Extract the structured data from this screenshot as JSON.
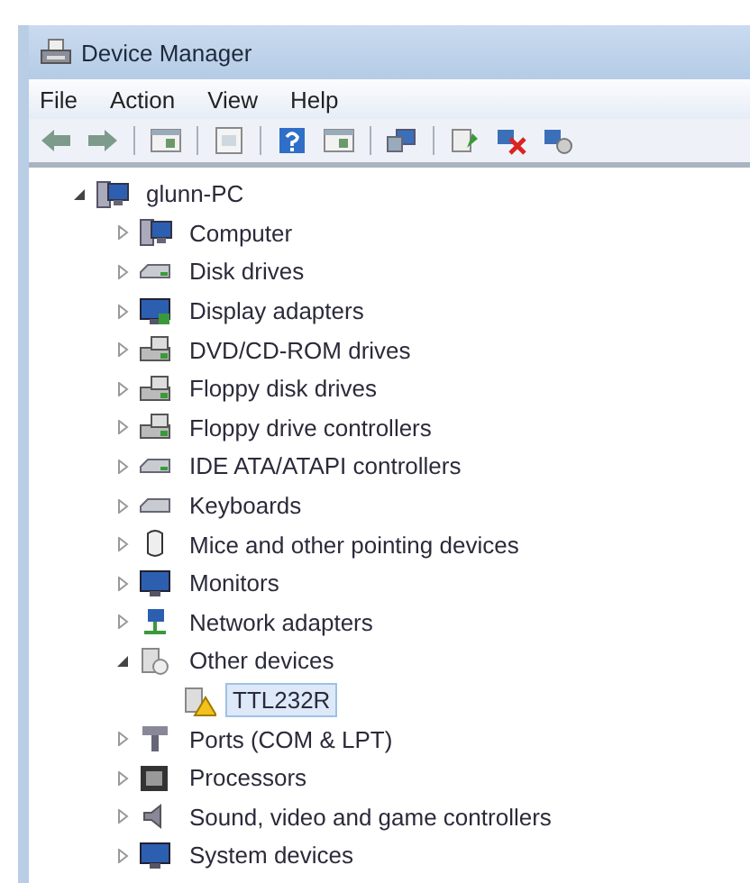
{
  "window": {
    "title": "Device Manager"
  },
  "menu": [
    {
      "label": "File"
    },
    {
      "label": "Action"
    },
    {
      "label": "View"
    },
    {
      "label": "Help"
    }
  ],
  "toolbar": [
    {
      "kind": "back"
    },
    {
      "kind": "forward"
    },
    {
      "kind": "sep"
    },
    {
      "kind": "pane"
    },
    {
      "kind": "sep"
    },
    {
      "kind": "sheet"
    },
    {
      "kind": "sep"
    },
    {
      "kind": "help"
    },
    {
      "kind": "pane2"
    },
    {
      "kind": "sep"
    },
    {
      "kind": "scan"
    },
    {
      "kind": "sep"
    },
    {
      "kind": "update"
    },
    {
      "kind": "uninstall"
    },
    {
      "kind": "disable"
    }
  ],
  "tree": [
    {
      "label": "glunn-PC",
      "kind": "root",
      "expanded": true,
      "selected": false,
      "children": [
        {
          "label": "Computer",
          "kind": "computer",
          "expanded": false,
          "selected": false
        },
        {
          "label": "Disk drives",
          "kind": "disk",
          "expanded": false,
          "selected": false
        },
        {
          "label": "Display adapters",
          "kind": "display",
          "expanded": false,
          "selected": false
        },
        {
          "label": "DVD/CD-ROM drives",
          "kind": "optical",
          "expanded": false,
          "selected": false
        },
        {
          "label": "Floppy disk drives",
          "kind": "floppy",
          "expanded": false,
          "selected": false
        },
        {
          "label": "Floppy drive controllers",
          "kind": "floppy",
          "expanded": false,
          "selected": false
        },
        {
          "label": "IDE ATA/ATAPI controllers",
          "kind": "disk",
          "expanded": false,
          "selected": false
        },
        {
          "label": "Keyboards",
          "kind": "keyboard",
          "expanded": false,
          "selected": false
        },
        {
          "label": "Mice and other pointing devices",
          "kind": "mouse",
          "expanded": false,
          "selected": false
        },
        {
          "label": "Monitors",
          "kind": "monitor",
          "expanded": false,
          "selected": false
        },
        {
          "label": "Network adapters",
          "kind": "network",
          "expanded": false,
          "selected": false
        },
        {
          "label": "Other devices",
          "kind": "unknown",
          "expanded": true,
          "selected": false,
          "children": [
            {
              "label": "TTL232R",
              "kind": "warning",
              "selected": true
            }
          ]
        },
        {
          "label": "Ports (COM & LPT)",
          "kind": "port",
          "expanded": false,
          "selected": false
        },
        {
          "label": "Processors",
          "kind": "processor",
          "expanded": false,
          "selected": false
        },
        {
          "label": "Sound, video and game controllers",
          "kind": "sound",
          "expanded": false,
          "selected": false
        },
        {
          "label": "System devices",
          "kind": "system",
          "expanded": false,
          "selected": false
        }
      ]
    }
  ]
}
